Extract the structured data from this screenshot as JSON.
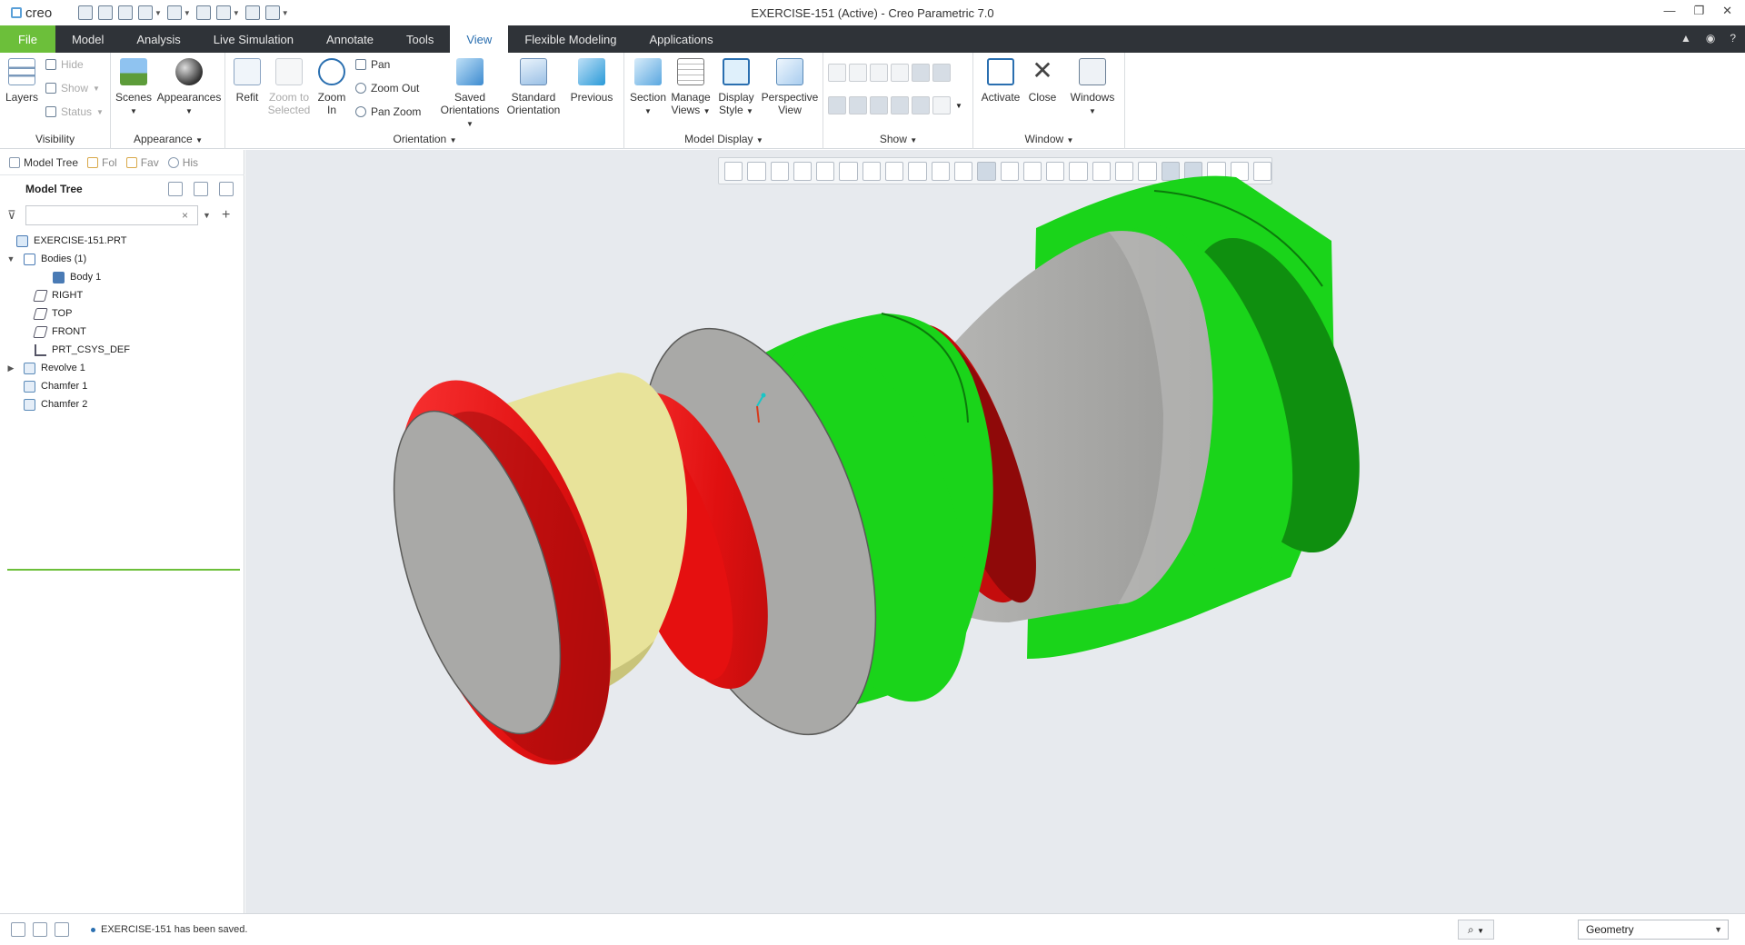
{
  "window": {
    "app_name": "creo",
    "title": "EXERCISE-151 (Active) - Creo Parametric 7.0",
    "controls": [
      "—",
      "❐",
      "✕"
    ]
  },
  "quick_access": {
    "icons": [
      "new-icon",
      "open-icon",
      "save-icon",
      "undo-icon",
      "redo-icon",
      "regenerate-icon",
      "windows-icon",
      "close-window-icon",
      "customize-icon"
    ]
  },
  "tabs": [
    {
      "label": "File",
      "active": false
    },
    {
      "label": "Model",
      "active": false
    },
    {
      "label": "Analysis",
      "active": false
    },
    {
      "label": "Live Simulation",
      "active": false
    },
    {
      "label": "Annotate",
      "active": false
    },
    {
      "label": "Tools",
      "active": false
    },
    {
      "label": "View",
      "active": true
    },
    {
      "label": "Flexible Modeling",
      "active": false
    },
    {
      "label": "Applications",
      "active": false
    }
  ],
  "ribbon": {
    "visibility": {
      "label": "Visibility",
      "layers": "Layers",
      "hide": "Hide",
      "show": "Show",
      "status": "Status"
    },
    "appearance": {
      "label": "Appearance",
      "scenes": "Scenes",
      "appearances": "Appearances"
    },
    "orientation": {
      "label": "Orientation",
      "refit": "Refit",
      "zoom_to_selected_1": "Zoom to",
      "zoom_to_selected_2": "Selected",
      "zoom_in_1": "Zoom",
      "zoom_in_2": "In",
      "pan": "Pan",
      "zoom_out": "Zoom Out",
      "pan_zoom": "Pan Zoom",
      "saved_orientations_1": "Saved",
      "saved_orientations_2": "Orientations",
      "standard_orientation_1": "Standard",
      "standard_orientation_2": "Orientation",
      "previous": "Previous"
    },
    "model_display": {
      "label": "Model Display",
      "section": "Section",
      "manage_views_1": "Manage",
      "manage_views_2": "Views",
      "display_style_1": "Display",
      "display_style_2": "Style",
      "perspective_view_1": "Perspective",
      "perspective_view_2": "View"
    },
    "show": {
      "label": "Show"
    },
    "window": {
      "label": "Window",
      "activate": "Activate",
      "close": "Close",
      "windows": "Windows"
    }
  },
  "nav_tabs": [
    {
      "label": "Model Tree"
    },
    {
      "label": "Fol"
    },
    {
      "label": "Fav"
    },
    {
      "label": "His"
    }
  ],
  "model_tree": {
    "header": "Model Tree",
    "search_value": "",
    "clear_symbol": "×",
    "add_symbol": "+",
    "nodes": [
      {
        "label": "EXERCISE-151.PRT",
        "toggle": ""
      },
      {
        "label": "Bodies (1)",
        "toggle": "▼"
      },
      {
        "label": "Body 1",
        "toggle": ""
      },
      {
        "label": "RIGHT",
        "toggle": ""
      },
      {
        "label": "TOP",
        "toggle": ""
      },
      {
        "label": "FRONT",
        "toggle": ""
      },
      {
        "label": "PRT_CSYS_DEF",
        "toggle": ""
      },
      {
        "label": "Revolve 1",
        "toggle": "▶"
      },
      {
        "label": "Chamfer 1",
        "toggle": ""
      },
      {
        "label": "Chamfer 2",
        "toggle": ""
      }
    ]
  },
  "status": {
    "message": "EXERCISE-151 has been saved.",
    "filter_value": "Geometry"
  },
  "model_colors": {
    "green": "#1ad41a",
    "green_dark": "#0f8f0f",
    "red": "#ee1111",
    "red_dark": "#9a0a0a",
    "yellow": "#e8e39a",
    "gray": "#a9a9a7",
    "gray_dark": "#6c6c6a"
  }
}
